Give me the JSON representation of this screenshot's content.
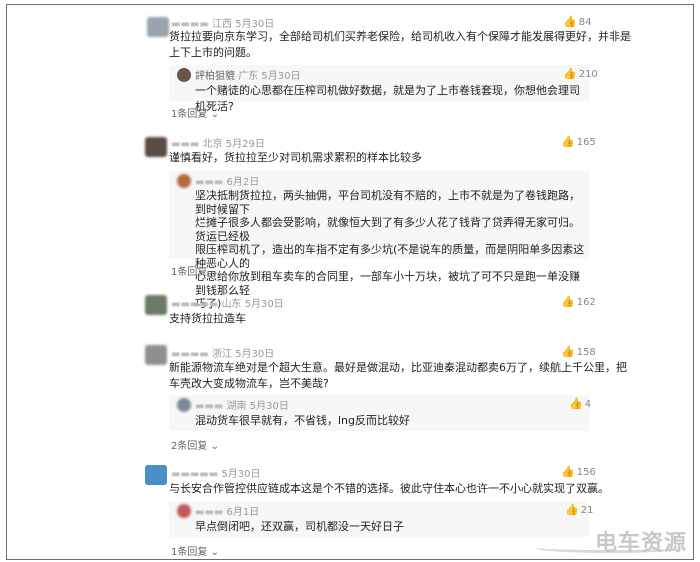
{
  "comments": [
    {
      "location": "江西",
      "date": "5月30日",
      "text_line1": "货拉拉要向京东学习，全部给司机们买养老保险，给司机收入有个保障才能发展得更好，并非是",
      "text_line2": "上下上市的问题。",
      "likes": "84",
      "replies": [
        {
          "name": "評柏狙貔",
          "location": "广东",
          "date": "5月30日",
          "text": "一个赌徒的心思都在压榨司机做好数据，就是为了上市卷钱套现，你想他会理司机死活?",
          "likes": "210"
        }
      ],
      "more": "1条回复"
    },
    {
      "location": "北京",
      "date": "5月29日",
      "text_line1": "谨慎看好，货拉拉至少对司机需求累积的样本比较多",
      "likes": "165",
      "replies": [
        {
          "date": "6月2日",
          "text_lines": [
            "坚决抵制货拉拉，两头抽佣，平台司机没有不赔的，上市不就是为了卷钱跑路，到时候留下",
            "烂摊子很多人都会受影响，就像恒大到了有多少人花了钱背了贷弄得无家可归。货运已经极",
            "限压榨司机了，造出的车指不定有多少坑(不是说车的质量，而是阴阳单多因素这种恶心人的",
            "心思给你放到租车卖车的合同里，一部车小十万块，被坑了可不只是跑一单没赚到钱那么轻",
            "巧了)"
          ]
        }
      ],
      "more": "1条回复"
    },
    {
      "location": "山东",
      "date": "5月30日",
      "text_line1": "支持货拉拉造车",
      "likes": "162"
    },
    {
      "location": "浙江",
      "date": "5月30日",
      "text_line1": "新能源物流车绝对是个超大生意。最好是做混动，比亚迪秦混动都卖6万了，续航上千公里，把",
      "text_line2": "车壳改大变成物流车，岂不美哉?",
      "likes": "158",
      "replies": [
        {
          "location": "湖南",
          "date": "5月30日",
          "text": "混动货车很早就有，不省钱，lng反而比较好",
          "likes": "4"
        }
      ],
      "more": "2条回复"
    },
    {
      "date": "5月30日",
      "text_line1": "与长安合作管控供应链成本这是个不错的选择。彼此守住本心也许一不小心就实现了双赢。",
      "likes": "156",
      "replies": [
        {
          "date": "6月1日",
          "text": "早点倒闭吧，还双赢，司机都没一天好日子",
          "likes": "21"
        }
      ],
      "more": "1条回复"
    }
  ],
  "icons": {
    "like": "thumbs-up-icon",
    "expand": "chevron-down-icon"
  },
  "watermark": "电车资源"
}
